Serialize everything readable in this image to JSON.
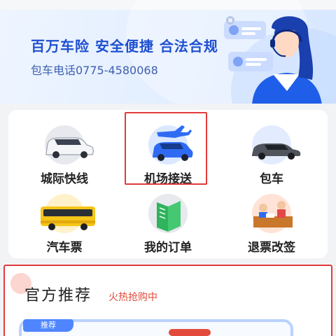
{
  "banner": {
    "headline": "百万车险 安全便捷 合法合规",
    "hotline": "包车电话0775-4580068"
  },
  "services": [
    {
      "label": "城际快线",
      "icon": "intercity-car-icon"
    },
    {
      "label": "机场接送",
      "icon": "airport-transfer-icon"
    },
    {
      "label": "包车",
      "icon": "charter-car-icon"
    },
    {
      "label": "汽车票",
      "icon": "bus-ticket-icon"
    },
    {
      "label": "我的订单",
      "icon": "my-orders-icon"
    },
    {
      "label": "退票改签",
      "icon": "refund-change-icon"
    }
  ],
  "recommend": {
    "title": "官方推荐",
    "subtitle": "火热抢购中",
    "product_tag": "推荐"
  },
  "colors": {
    "accent_blue": "#1f4fd1",
    "highlight_red": "#e23b3b",
    "background": "#f2f3f5"
  }
}
